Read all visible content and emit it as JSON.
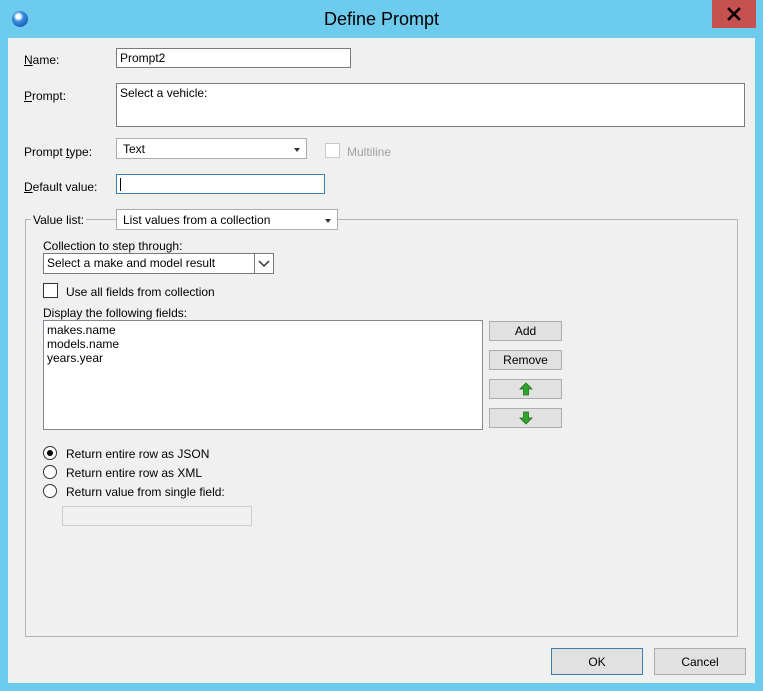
{
  "window": {
    "title": "Define Prompt"
  },
  "form": {
    "name_label_accel": "N",
    "name_label_rest": "ame:",
    "name_value": "Prompt2",
    "prompt_label_accel": "P",
    "prompt_label_rest": "rompt:",
    "prompt_value": "Select a vehicle:",
    "prompt_type_label_pre": "Prompt ",
    "prompt_type_label_accel": "t",
    "prompt_type_label_rest": "ype:",
    "prompt_type_value": "Text",
    "multiline_label": "Multiline",
    "default_value_label_accel": "D",
    "default_value_label_rest": "efault value:",
    "default_value": ""
  },
  "value_list": {
    "label": "Value list:",
    "mode": "List values from a collection",
    "collection_label": "Collection to step through:",
    "collection_value": "Select a make and model result",
    "use_all_fields_label": "Use all fields from collection",
    "display_fields_label": "Display the following fields:",
    "fields": [
      "makes.name",
      "models.name",
      "years.year"
    ],
    "add_label": "Add",
    "remove_label": "Remove",
    "return_options": [
      {
        "label": "Return entire row as JSON",
        "selected": true
      },
      {
        "label": "Return entire row as XML",
        "selected": false
      },
      {
        "label": "Return value from single field:",
        "selected": false
      }
    ],
    "single_field_value": ""
  },
  "footer": {
    "ok_label": "OK",
    "cancel_label": "Cancel"
  },
  "colors": {
    "titlebar": "#6dcbee",
    "close": "#c75050",
    "arrow_green": "#2fa52f"
  }
}
